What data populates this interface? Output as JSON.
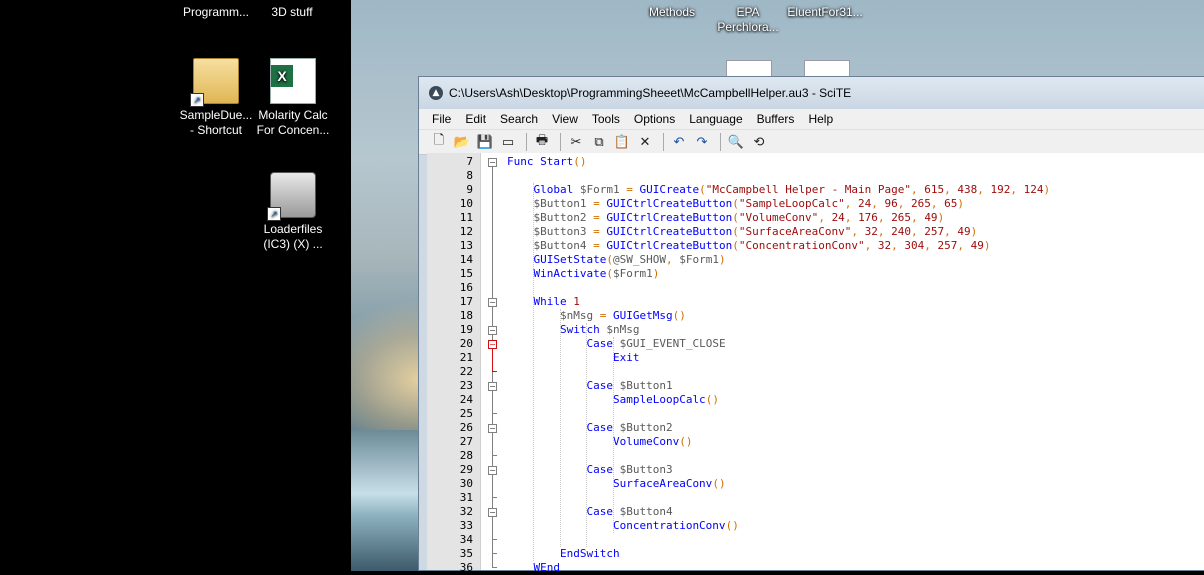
{
  "desktop": {
    "icons": [
      {
        "label_top": "Programm...",
        "label_bottom": ""
      },
      {
        "label_top": "3D stuff",
        "label_bottom": ""
      },
      {
        "label_top": "SampleDue...",
        "label_bottom": "- Shortcut"
      },
      {
        "label_top": "Molarity Calc",
        "label_bottom": "For Concen..."
      },
      {
        "label_top": "Loaderfiles",
        "label_bottom": "(IC3) (X) ..."
      },
      {
        "label_top": "Methods",
        "label_bottom": ""
      },
      {
        "label_top": "EPA",
        "label_bottom": "Perchlora..."
      },
      {
        "label_top": "EluentFor31...",
        "label_bottom": ""
      }
    ]
  },
  "window": {
    "title": "C:\\Users\\Ash\\Desktop\\ProgrammingSheeet\\McCampbellHelper.au3 - SciTE",
    "menu": [
      "File",
      "Edit",
      "Search",
      "View",
      "Tools",
      "Options",
      "Language",
      "Buffers",
      "Help"
    ],
    "toolbar": [
      {
        "name": "new-file-icon",
        "glyph": "🗋"
      },
      {
        "name": "open-folder-icon",
        "glyph": "📂"
      },
      {
        "name": "save-icon",
        "glyph": "💾"
      },
      {
        "name": "close-file-icon",
        "glyph": "▭"
      },
      {
        "name": "print-icon",
        "glyph": "🖶"
      },
      {
        "name": "cut-icon",
        "glyph": "✂"
      },
      {
        "name": "copy-icon",
        "glyph": "⧉"
      },
      {
        "name": "paste-icon",
        "glyph": "📋"
      },
      {
        "name": "delete-icon",
        "glyph": "✕"
      },
      {
        "name": "undo-icon",
        "glyph": "↶"
      },
      {
        "name": "redo-icon",
        "glyph": "↷"
      },
      {
        "name": "find-icon",
        "glyph": "🔍"
      },
      {
        "name": "replace-icon",
        "glyph": "⟲"
      }
    ]
  },
  "code": [
    {
      "n": "7",
      "text": "Func Start()"
    },
    {
      "n": "8",
      "text": ""
    },
    {
      "n": "9",
      "text": "    Global $Form1 = GUICreate(\"McCampbell Helper - Main Page\", 615, 438, 192, 124)"
    },
    {
      "n": "10",
      "text": "    $Button1 = GUICtrlCreateButton(\"SampleLoopCalc\", 24, 96, 265, 65)"
    },
    {
      "n": "11",
      "text": "    $Button2 = GUICtrlCreateButton(\"VolumeConv\", 24, 176, 265, 49)"
    },
    {
      "n": "12",
      "text": "    $Button3 = GUICtrlCreateButton(\"SurfaceAreaConv\", 32, 240, 257, 49)"
    },
    {
      "n": "13",
      "text": "    $Button4 = GUICtrlCreateButton(\"ConcentrationConv\", 32, 304, 257, 49)"
    },
    {
      "n": "14",
      "text": "    GUISetState(@SW_SHOW, $Form1)"
    },
    {
      "n": "15",
      "text": "    WinActivate($Form1)"
    },
    {
      "n": "16",
      "text": ""
    },
    {
      "n": "17",
      "text": "    While 1"
    },
    {
      "n": "18",
      "text": "        $nMsg = GUIGetMsg()"
    },
    {
      "n": "19",
      "text": "        Switch $nMsg"
    },
    {
      "n": "20",
      "text": "            Case $GUI_EVENT_CLOSE"
    },
    {
      "n": "21",
      "text": "                Exit"
    },
    {
      "n": "22",
      "text": ""
    },
    {
      "n": "23",
      "text": "            Case $Button1"
    },
    {
      "n": "24",
      "text": "                SampleLoopCalc()"
    },
    {
      "n": "25",
      "text": ""
    },
    {
      "n": "26",
      "text": "            Case $Button2"
    },
    {
      "n": "27",
      "text": "                VolumeConv()"
    },
    {
      "n": "28",
      "text": ""
    },
    {
      "n": "29",
      "text": "            Case $Button3"
    },
    {
      "n": "30",
      "text": "                SurfaceAreaConv()"
    },
    {
      "n": "31",
      "text": ""
    },
    {
      "n": "32",
      "text": "            Case $Button4"
    },
    {
      "n": "33",
      "text": "                ConcentrationConv()"
    },
    {
      "n": "34",
      "text": ""
    },
    {
      "n": "35",
      "text": "        EndSwitch"
    },
    {
      "n": "36",
      "text": "    WEnd"
    }
  ],
  "colors": {
    "keyword": "#0000ff",
    "string": "#9e0a0a",
    "variable": "#5a5a5a",
    "operator": "#d07000",
    "fold_active": "#d01010"
  }
}
